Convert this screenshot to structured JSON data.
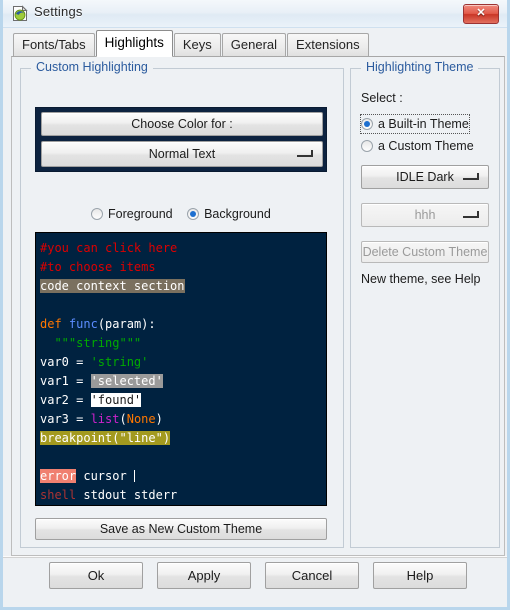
{
  "window": {
    "title": "Settings",
    "icon": "idle-python-icon",
    "close_label": "✕"
  },
  "tabs": [
    {
      "label": "Fonts/Tabs",
      "active": false
    },
    {
      "label": "Highlights",
      "active": true
    },
    {
      "label": "Keys",
      "active": false
    },
    {
      "label": "General",
      "active": false
    },
    {
      "label": "Extensions",
      "active": false
    }
  ],
  "left_panel": {
    "title": "Custom Highlighting",
    "choose_color_label": "Choose Color for :",
    "element_combo_value": "Normal Text",
    "fg_label": "Foreground",
    "bg_label": "Background",
    "fg_selected": false,
    "bg_selected": true,
    "save_button_label": "Save as New Custom Theme",
    "frame_color": "#0d2340"
  },
  "code_sample": {
    "background": "#002240",
    "lines": [
      {
        "id": "comment1",
        "text": "#you can click here"
      },
      {
        "id": "comment2",
        "text": "#to choose items"
      },
      {
        "id": "context",
        "text": "code context section"
      },
      {
        "id": "blank1",
        "text": ""
      },
      {
        "id": "def",
        "kw": "def",
        "name": "func",
        "rest": "(param):"
      },
      {
        "id": "docstring",
        "text": "  \"\"\"string\"\"\""
      },
      {
        "id": "var0",
        "prefix": "var0 = ",
        "value": "'string'"
      },
      {
        "id": "var1",
        "prefix": "var1 = ",
        "value": "'selected'"
      },
      {
        "id": "var2",
        "prefix": "var2 = ",
        "value": "'found'"
      },
      {
        "id": "var3",
        "prefix": "var3 = ",
        "builtin": "list",
        "arg": "None"
      },
      {
        "id": "breakpoint",
        "text": "breakpoint(\"line\")"
      },
      {
        "id": "blank2",
        "text": ""
      },
      {
        "id": "error",
        "error": "error",
        "cursor": " cursor "
      },
      {
        "id": "shell",
        "shell": "shell",
        "rest": " stdout stderr"
      }
    ],
    "colors": {
      "comment": "#dd0000",
      "keyword": "#ff7700",
      "definition": "#5b8cff",
      "string": "#00aa00",
      "builtin": "#cc22cc",
      "context_bg": "#7a705f",
      "selected_bg": "#9a9a9a",
      "found_bg": "#ffffff",
      "breakpoint_bg": "#a39a1f",
      "error_bg": "#f08070",
      "shell": "#aa3333"
    }
  },
  "right_panel": {
    "title": "Highlighting Theme",
    "select_label": "Select :",
    "builtin_radio_label": "a Built-in Theme",
    "custom_radio_label": "a Custom Theme",
    "builtin_selected": true,
    "custom_selected": false,
    "builtin_theme_value": "IDLE Dark",
    "custom_theme_value": "hhh",
    "delete_button_label": "Delete Custom Theme",
    "note": "New theme, see Help"
  },
  "bottom_buttons": {
    "ok": "Ok",
    "apply": "Apply",
    "cancel": "Cancel",
    "help": "Help"
  }
}
